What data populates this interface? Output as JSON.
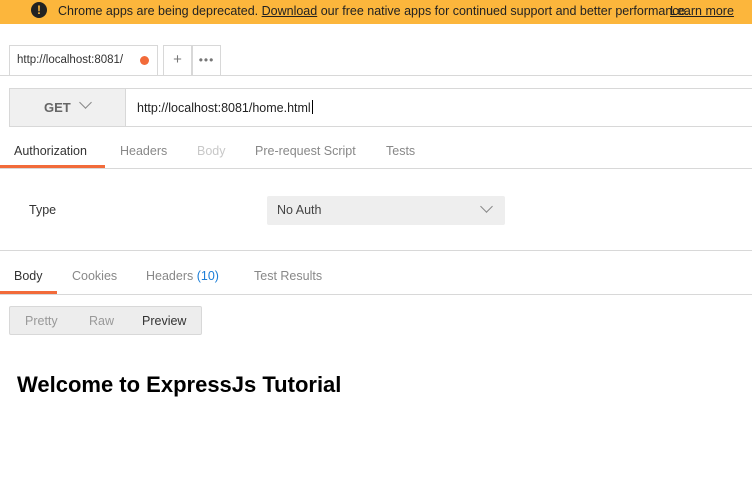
{
  "banner": {
    "message_prefix": "Chrome apps are being deprecated.",
    "download_link": "Download",
    "message_suffix": "our free native apps for continued support and better performance.",
    "learn_more": "Learn more",
    "icon": "warning-icon",
    "background": "#fcb63c"
  },
  "tabs": {
    "request_tab_label": "http://localhost:8081/",
    "unsaved_dot_color": "#f26b3a",
    "add_label": "+",
    "more_label": "•••"
  },
  "request": {
    "method": "GET",
    "url": "http://localhost:8081/home.html"
  },
  "request_tabs": [
    {
      "label": "Authorization",
      "state": "active"
    },
    {
      "label": "Headers",
      "state": "normal"
    },
    {
      "label": "Body",
      "state": "disabled"
    },
    {
      "label": "Pre-request Script",
      "state": "normal"
    },
    {
      "label": "Tests",
      "state": "normal"
    }
  ],
  "auth": {
    "type_label": "Type",
    "selected": "No Auth"
  },
  "response_tabs": [
    {
      "label": "Body",
      "state": "active"
    },
    {
      "label": "Cookies",
      "state": "normal"
    },
    {
      "label": "Headers",
      "state": "normal",
      "count": "(10)"
    },
    {
      "label": "Test Results",
      "state": "normal"
    }
  ],
  "view_modes": [
    {
      "label": "Pretty",
      "state": "normal"
    },
    {
      "label": "Raw",
      "state": "normal"
    },
    {
      "label": "Preview",
      "state": "active"
    }
  ],
  "preview": {
    "heading": "Welcome to ExpressJs Tutorial"
  },
  "accent_color": "#f26b3a"
}
